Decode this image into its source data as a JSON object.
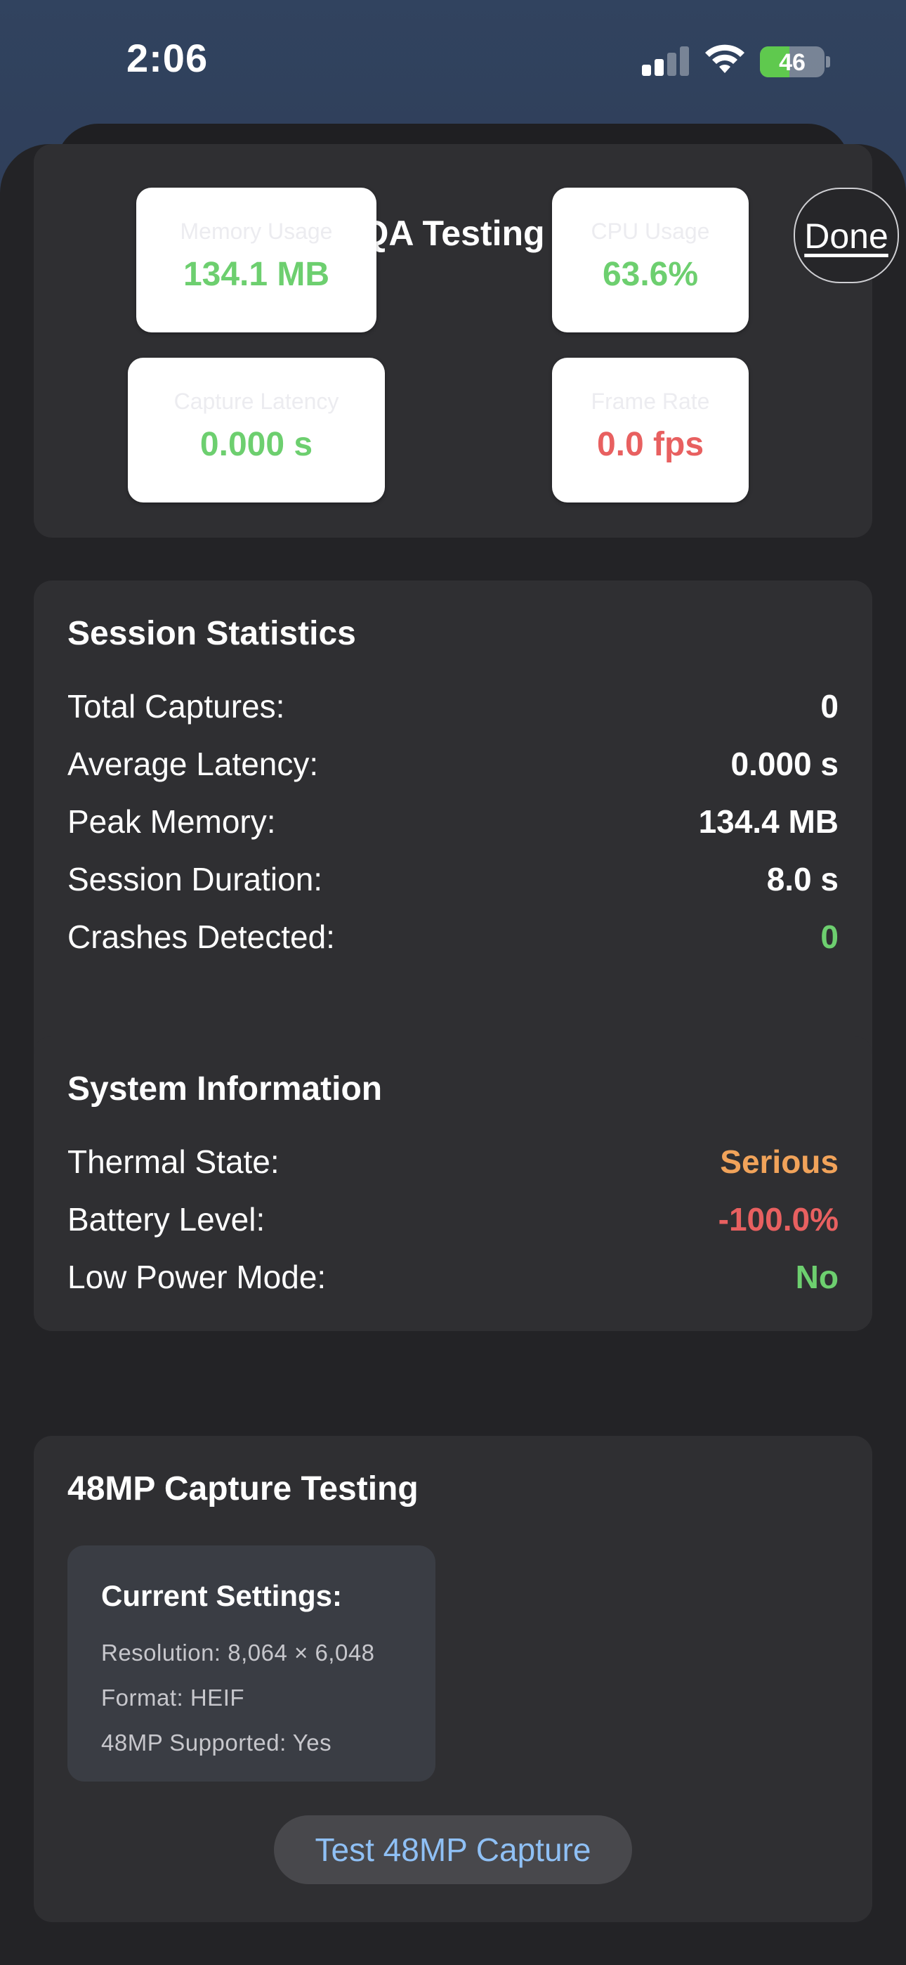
{
  "status_bar": {
    "time": "2:06",
    "battery": "46",
    "battery_level": 0.46
  },
  "nav": {
    "title": "QA Testing",
    "done_label": "Done"
  },
  "metrics": {
    "memory": {
      "label": "Memory Usage",
      "value": "134.1 MB"
    },
    "cpu": {
      "label": "CPU Usage",
      "value": "63.6%"
    },
    "latency": {
      "label": "Capture Latency",
      "value": "0.000 s"
    },
    "frame_rate": {
      "label": "Frame Rate",
      "value": "0.0 fps"
    }
  },
  "session": {
    "title": "Session Statistics",
    "rows": [
      {
        "label": "Total Captures:",
        "value": "0"
      },
      {
        "label": "Average Latency:",
        "value": "0.000 s"
      },
      {
        "label": "Peak Memory:",
        "value": "134.4 MB"
      },
      {
        "label": "Session Duration:",
        "value": "8.0 s"
      },
      {
        "label": "Crashes Detected:",
        "value": "0"
      }
    ]
  },
  "system": {
    "title": "System Information",
    "rows": [
      {
        "label": "Thermal State:",
        "value": "Serious"
      },
      {
        "label": "Battery Level:",
        "value": "-100.0%"
      },
      {
        "label": "Low Power Mode:",
        "value": "No"
      }
    ]
  },
  "capture48": {
    "title": "48MP Capture Testing",
    "settings_title": "Current Settings:",
    "resolution": "Resolution: 8,064 × 6,048",
    "format": "Format: HEIF",
    "supported": "48MP Supported: Yes",
    "button": "Test 48MP Capture"
  },
  "colors": {
    "good": "#6dcf6f",
    "bad": "#e86060",
    "warn": "#f1a35a",
    "link": "#8fc0f5"
  }
}
